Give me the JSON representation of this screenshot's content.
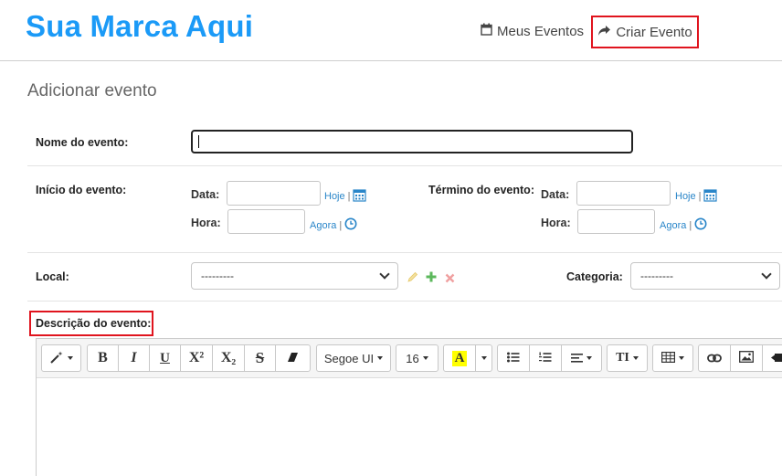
{
  "header": {
    "brand": "Sua Marca Aqui",
    "nav": {
      "my_events": "Meus Eventos",
      "create_event": "Criar Evento"
    }
  },
  "page_title": "Adicionar evento",
  "form": {
    "name_label": "Nome do evento:",
    "name_value": "",
    "start_label": "Início do evento:",
    "end_label": "Término do evento:",
    "date_label": "Data:",
    "time_label": "Hora:",
    "today_link": "Hoje",
    "now_link": "Agora",
    "link_sep": "|",
    "location_label": "Local:",
    "location_selected": "---------",
    "category_label": "Categoria:",
    "category_selected": "---------",
    "description_label": "Descrição do evento:"
  },
  "toolbar": {
    "font_family": "Segoe UI",
    "font_size": "16",
    "color_letter": "A",
    "bold": "B",
    "italic": "I",
    "underline": "U",
    "superscript": "X²",
    "subscript": "X₂",
    "strikethrough": "S",
    "text_size_letter": "TI"
  },
  "colors": {
    "brand": "#1b9af7",
    "highlight": "#e0141e",
    "link": "#2a86c9",
    "add_icon": "#5cb85c",
    "remove_icon": "#f0a0a0"
  }
}
